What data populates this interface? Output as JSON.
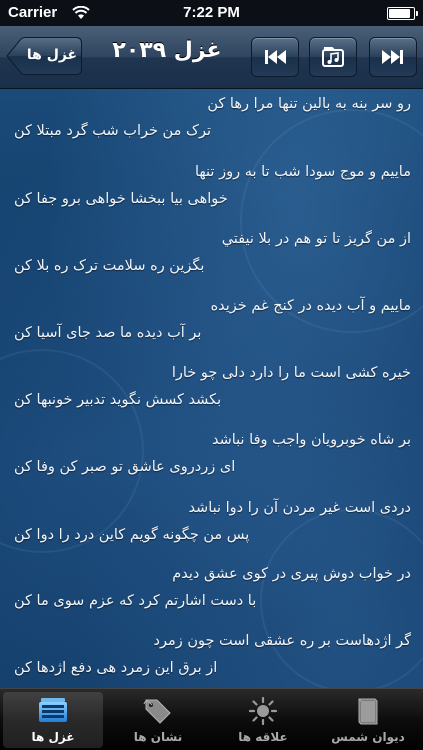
{
  "status_bar": {
    "carrier": "Carrier",
    "time": "7:22 PM",
    "battery_level": 0.95
  },
  "nav": {
    "back_label": "غزل ها",
    "title": "غزل ۲۰۳۹"
  },
  "verses": [
    {
      "line1": "رو سر بنه به بالین تنها مرا رها کن",
      "line2": "ترک من خراب شب گرد مبتلا کن"
    },
    {
      "line1": "ماییم و موج سودا شب تا به روز تنها",
      "line2": "خواهی بیا ببخشا خواهی برو جفا کن"
    },
    {
      "line1": "از من گریز تا تو هم در بلا نیفتي",
      "line2": "بگزین ره سلامت ترک ره بلا کن"
    },
    {
      "line1": "ماییم و آب دیده در کنج غم خزیده",
      "line2": "بر آب دیده ما صد جای آسیا کن"
    },
    {
      "line1": "خیره کشی است ما را دارد دلی چو خارا",
      "line2": "بکشد کسش نگوید تدبیر خونبها کن"
    },
    {
      "line1": "بر شاه خوبرویان واجب وفا نباشد",
      "line2": "ای زردروی عاشق تو صبر کن وفا کن"
    },
    {
      "line1": "دردی است غیر مردن آن را دوا نباشد",
      "line2": "پس من چگونه گویم کاین درد را دوا کن"
    },
    {
      "line1": "در خواب دوش پیری در کوی عشق دیدم",
      "line2": "با دست اشارتم کرد که عزم سوی ما کن"
    },
    {
      "line1": "گر اژدهاست بر ره عشقی است چون زمرد",
      "line2": "از برق این زمرد هی دفع اژدها کن"
    }
  ],
  "tabs": [
    {
      "label": "غزل ها",
      "icon": "ghazal-list-icon",
      "active": true
    },
    {
      "label": "نشان ها",
      "icon": "tag-icon",
      "active": false
    },
    {
      "label": "علاقه ها",
      "icon": "sun-icon",
      "active": false
    },
    {
      "label": "دیوان شمس",
      "icon": "book-icon",
      "active": false
    }
  ],
  "colors": {
    "accent": "#1a4a78",
    "navbar": "#2f4560",
    "text": "#f2f4f8"
  }
}
